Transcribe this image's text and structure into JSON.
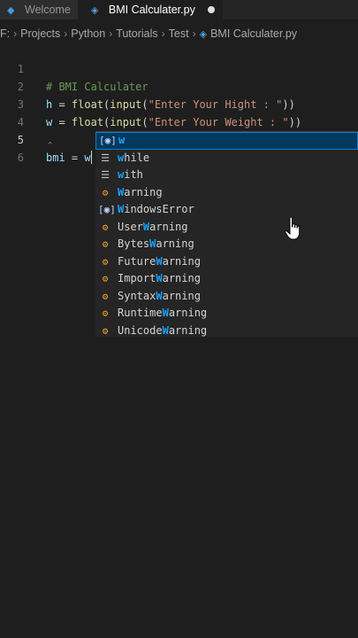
{
  "tabs": [
    {
      "label": "Welcome",
      "icon": "vscode-icon"
    },
    {
      "label": "BMI Calculater.py",
      "icon": "python-icon"
    }
  ],
  "breadcrumb": [
    "F:",
    "Projects",
    "Python",
    "Tutorials",
    "Test",
    "BMI Calculater.py"
  ],
  "editor": {
    "lines": [
      {
        "number": "1",
        "comment": "# BMI Calculater"
      },
      {
        "number": "2",
        "var": "h",
        "eq": " = ",
        "fn1": "float",
        "p1": "(",
        "fn2": "input",
        "p2": "(",
        "str": "\"Enter Your Hight : \"",
        "close": "))"
      },
      {
        "number": "3",
        "var": "w",
        "eq": " = ",
        "fn1": "float",
        "p1": "(",
        "fn2": "input",
        "p2": "(",
        "str": "\"Enter Your Weight : \"",
        "close": "))"
      },
      {
        "number": "4"
      },
      {
        "number": "5",
        "var": "bmi",
        "eq": " = ",
        "typed": "w"
      },
      {
        "number": "6"
      }
    ]
  },
  "suggestions": [
    {
      "prefix": "",
      "match": "w",
      "suffix": "",
      "kind": "variable"
    },
    {
      "prefix": "",
      "match": "w",
      "suffix": "hile",
      "kind": "keyword"
    },
    {
      "prefix": "",
      "match": "w",
      "suffix": "ith",
      "kind": "keyword"
    },
    {
      "prefix": "",
      "match": "W",
      "suffix": "arning",
      "kind": "class"
    },
    {
      "prefix": "",
      "match": "W",
      "suffix": "indowsError",
      "kind": "variable"
    },
    {
      "prefix": "User",
      "match": "W",
      "suffix": "arning",
      "kind": "class"
    },
    {
      "prefix": "Bytes",
      "match": "W",
      "suffix": "arning",
      "kind": "class"
    },
    {
      "prefix": "Future",
      "match": "W",
      "suffix": "arning",
      "kind": "class"
    },
    {
      "prefix": "Import",
      "match": "W",
      "suffix": "arning",
      "kind": "class"
    },
    {
      "prefix": "Syntax",
      "match": "W",
      "suffix": "arning",
      "kind": "class"
    },
    {
      "prefix": "Runtime",
      "match": "W",
      "suffix": "arning",
      "kind": "class"
    },
    {
      "prefix": "Unicode",
      "match": "W",
      "suffix": "arning",
      "kind": "class"
    }
  ],
  "colors": {
    "background": "#1e1e1e",
    "accent": "#007fd4",
    "match": "#18a3ff",
    "class_icon": "#ee9d28"
  }
}
